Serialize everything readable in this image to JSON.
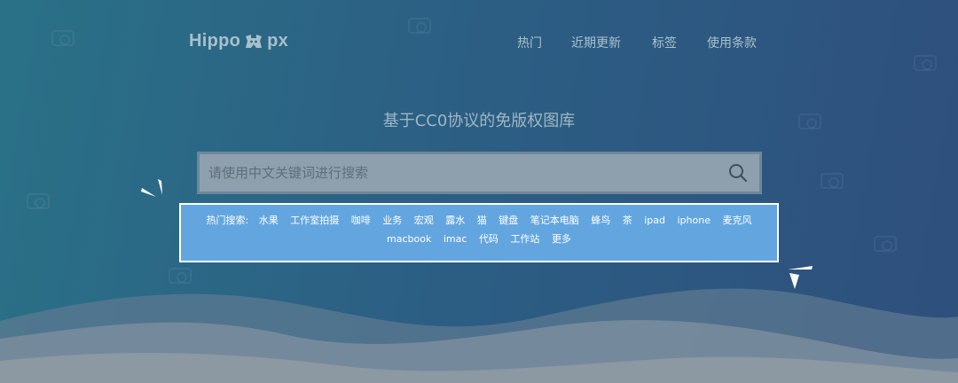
{
  "header": {
    "logo_text_left": "Hippo",
    "logo_text_right": "px",
    "nav": [
      "热门",
      "近期更新",
      "标签",
      "使用条款"
    ]
  },
  "hero": {
    "title": "基于CC0协议的免版权图库"
  },
  "search": {
    "placeholder": "请使用中文关键词进行搜索",
    "icon": "search-icon"
  },
  "hot_search": {
    "label": "热门搜索:",
    "keywords": [
      "水果",
      "工作室拍摄",
      "咖啡",
      "业务",
      "宏观",
      "露水",
      "猫",
      "键盘",
      "笔记本电脑",
      "蜂鸟",
      "茶",
      "ipad",
      "iphone",
      "麦克风",
      "macbook",
      "imac",
      "代码",
      "工作站",
      "更多"
    ]
  },
  "colors": {
    "bg_left": "#2a7187",
    "bg_right": "#2e4f7c",
    "hot_box": "#63a6df",
    "hot_border": "#ffffff"
  }
}
